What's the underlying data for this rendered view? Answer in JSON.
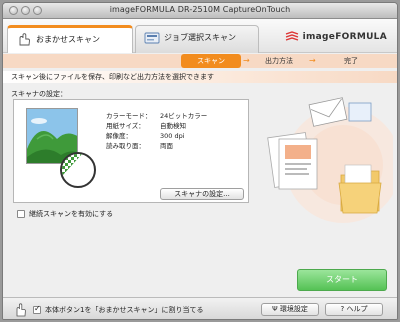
{
  "window": {
    "title": "imageFORMULA DR-2510M CaptureOnTouch"
  },
  "tabs": [
    {
      "label": "おまかせスキャン",
      "active": true
    },
    {
      "label": "ジョブ選択スキャン",
      "active": false
    }
  ],
  "logo": {
    "text": "imageFORMULA"
  },
  "steps": [
    {
      "label": "スキャン",
      "active": true
    },
    {
      "label": "出力方法",
      "active": false
    },
    {
      "label": "完了",
      "active": false
    }
  ],
  "banner": {
    "text": "スキャン後にファイルを保存、印刷など出力方法を選択できます"
  },
  "scanner_settings": {
    "section_label": "スキャナの設定：",
    "rows": [
      {
        "key": "カラーモード：",
        "value": "24ビットカラー"
      },
      {
        "key": "用紙サイズ：",
        "value": "自動検知"
      },
      {
        "key": "解像度：",
        "value": "300 dpi"
      },
      {
        "key": "読み取り面：",
        "value": "両面"
      }
    ],
    "settings_button": "スキャナの設定..."
  },
  "continuous_scan": {
    "label": "継続スキャンを有効にする",
    "checked": false
  },
  "start_button": "スタート",
  "bottom": {
    "assign_label": "本体ボタン1を「おまかせスキャン」に割り当てる",
    "assign_checked": true,
    "env_button": "環境設定",
    "help_button": "ヘルプ"
  },
  "colors": {
    "accent": "#f28c1e",
    "step_bar": "#f7d9c4",
    "start": "#55c255"
  }
}
